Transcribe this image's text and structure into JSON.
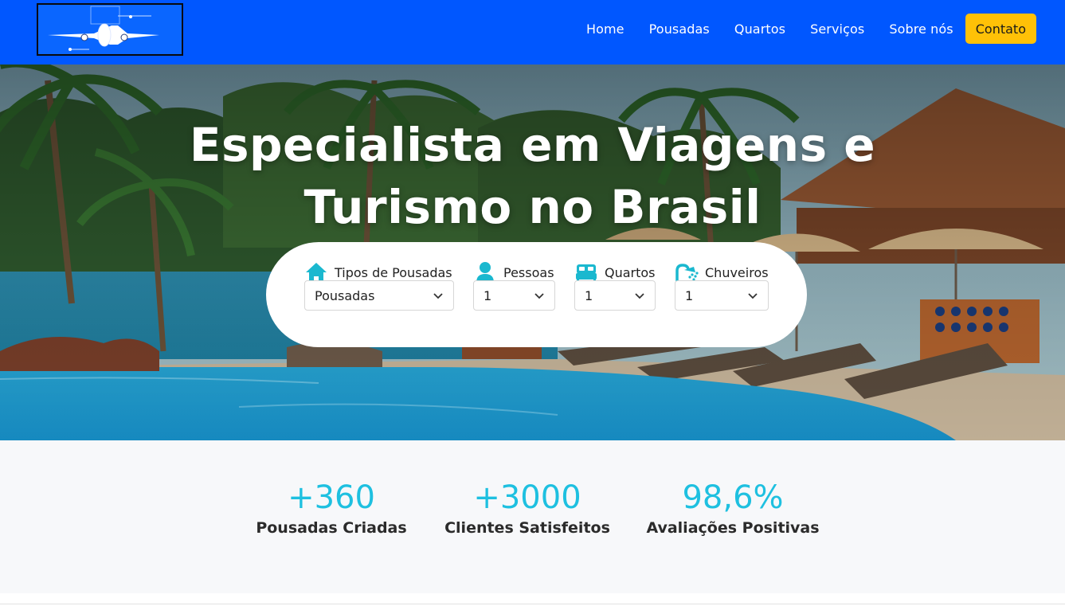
{
  "nav": {
    "logo_icon": "airplane-logo",
    "links": [
      "Home",
      "Pousadas",
      "Quartos",
      "Serviços",
      "Sobre nós"
    ],
    "contact_label": "Contato",
    "colors": {
      "bar": "#0057ff",
      "contact": "#ffc107"
    }
  },
  "hero": {
    "title_line1": "Especialista em Viagens e",
    "title_line2": "Turismo no Brasil",
    "background": "tropical-resort-pool-photo"
  },
  "search": {
    "fields": [
      {
        "label": "Tipos de Pousadas",
        "icon": "house-icon",
        "value": "Pousadas"
      },
      {
        "label": "Pessoas",
        "icon": "person-icon",
        "value": "1"
      },
      {
        "label": "Quartos",
        "icon": "bed-icon",
        "value": "1"
      },
      {
        "label": "Chuveiros",
        "icon": "shower-icon",
        "value": "1"
      }
    ],
    "accent": "#1ab8cf"
  },
  "stats": [
    {
      "value": "+360",
      "label": "Pousadas Criadas"
    },
    {
      "value": "+3000",
      "label": "Clientes Satisfeitos"
    },
    {
      "value": "98,6%",
      "label": "Avaliações Positivas"
    }
  ]
}
